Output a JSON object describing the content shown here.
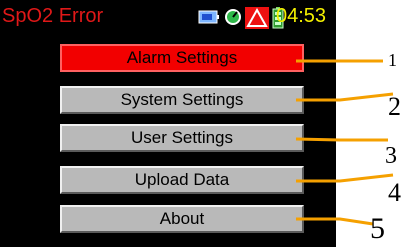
{
  "status_bar": {
    "title": "SpO2 Error",
    "time": "04:53",
    "icons": [
      "battery-icon",
      "gauge-icon",
      "alarm-warning-icon",
      "battery-level-icon"
    ]
  },
  "menu": {
    "items": [
      {
        "label": "Alarm Settings",
        "selected": true
      },
      {
        "label": "System Settings",
        "selected": false
      },
      {
        "label": "User Settings",
        "selected": false
      },
      {
        "label": "Upload Data",
        "selected": false
      },
      {
        "label": "About",
        "selected": false
      }
    ]
  },
  "callouts": [
    "1",
    "2",
    "3",
    "4",
    "5"
  ],
  "colors": {
    "title": "#e01818",
    "time": "#f4f000",
    "selected_button": "#f20000",
    "button": "#b9b9b9",
    "callout_line": "#f5a000"
  }
}
